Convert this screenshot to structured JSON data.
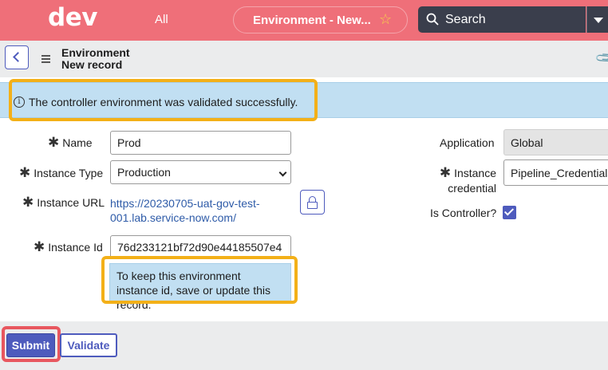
{
  "topbar": {
    "logo": "dev",
    "all_label": "All",
    "context_title": "Environment - New...",
    "search_placeholder": "Search"
  },
  "form_header": {
    "title_line1": "Environment",
    "title_line2": "New record"
  },
  "info_message": "The controller environment was validated successfully.",
  "fields": {
    "name": {
      "label": "Name",
      "value": "Prod"
    },
    "instance_type": {
      "label": "Instance Type",
      "value": "Production"
    },
    "instance_url": {
      "label": "Instance URL",
      "value_line1": "https://20230705-uat-gov-test-",
      "value_line2": "001.lab.service-now.com/"
    },
    "instance_id": {
      "label": "Instance Id",
      "value": "76d233121bf72d90e44185507e4"
    },
    "instance_id_hint": "To keep this environment instance id, save or update this record.",
    "application": {
      "label": "Application",
      "value": "Global"
    },
    "instance_credential": {
      "label_line1": "Instance",
      "label_line2": "credential",
      "value": "Pipeline_Credentials"
    },
    "is_controller": {
      "label": "Is Controller?",
      "checked": true
    }
  },
  "buttons": {
    "submit": "Submit",
    "validate": "Validate"
  },
  "colors": {
    "banner": "#ef6f79",
    "accent": "#4e5bbd",
    "info_bg": "#c1dff2",
    "highlight": "#f3b018",
    "submit_outline": "#e8575f"
  }
}
